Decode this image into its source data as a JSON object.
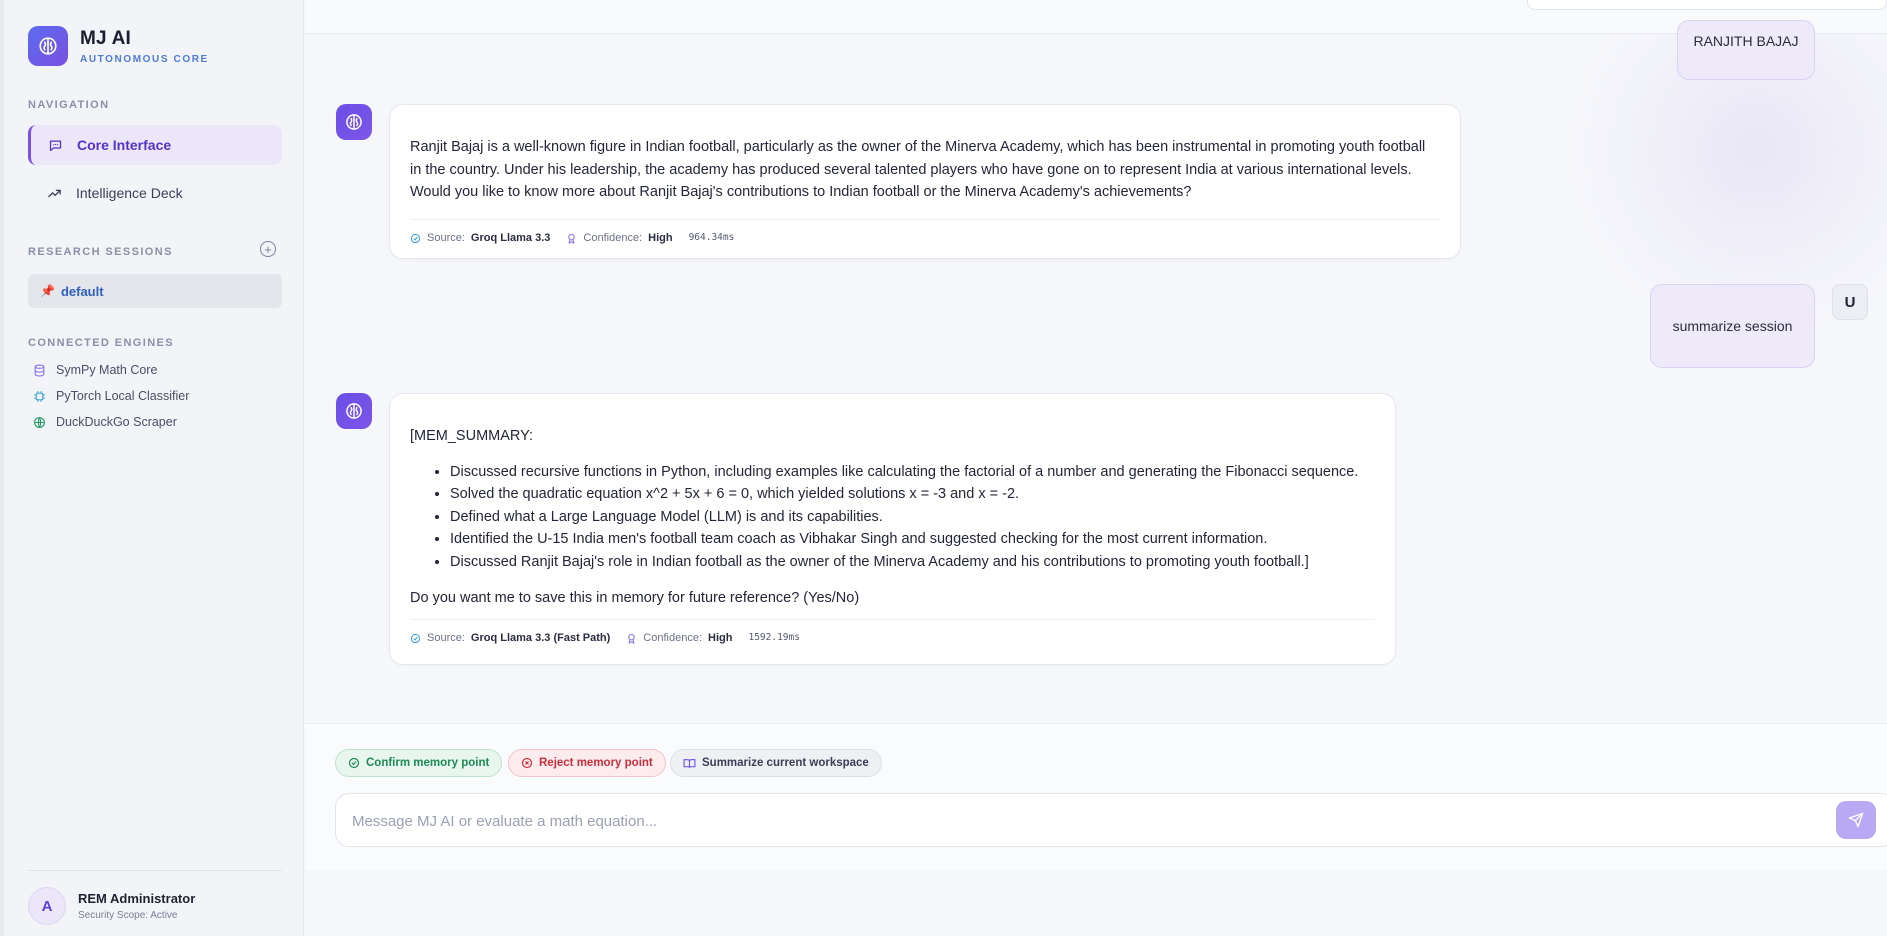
{
  "brand": {
    "title": "MJ AI",
    "subtitle": "AUTONOMOUS CORE"
  },
  "sidebar": {
    "navigation_label": "NAVIGATION",
    "nav_items": [
      {
        "label": "Core Interface",
        "icon": "chat-icon",
        "active": true
      },
      {
        "label": "Intelligence Deck",
        "icon": "trend-icon",
        "active": false
      }
    ],
    "sessions_label": "RESEARCH SESSIONS",
    "sessions": [
      {
        "label": "default",
        "icon": "pin-icon"
      }
    ],
    "engines_label": "CONNECTED ENGINES",
    "engines": [
      {
        "label": "SymPy Math Core",
        "icon": "database-icon",
        "color": "#8a6fe0"
      },
      {
        "label": "PyTorch Local Classifier",
        "icon": "cpu-icon",
        "color": "#3aa0d8"
      },
      {
        "label": "DuckDuckGo Scraper",
        "icon": "globe-icon",
        "color": "#1f9a63"
      }
    ],
    "user": {
      "initial": "A",
      "name": "REM Administrator",
      "scope": "Security Scope: Active"
    }
  },
  "chat": {
    "messages": [
      {
        "role": "user",
        "text": "RANJITH BAJAJ"
      },
      {
        "role": "ai",
        "text": "Ranjit Bajaj is a well-known figure in Indian football, particularly as the owner of the Minerva Academy, which has been instrumental in promoting youth football in the country. Under his leadership, the academy has produced several talented players who have gone on to represent India at various international levels. Would you like to know more about Ranjit Bajaj's contributions to Indian football or the Minerva Academy's achievements?",
        "source_label": "Source:",
        "source": "Groq Llama 3.3",
        "confidence_label": "Confidence:",
        "confidence": "High",
        "time": "964.34ms"
      },
      {
        "role": "user",
        "initial": "U",
        "text": "summarize session"
      },
      {
        "role": "ai",
        "heading": "[MEM_SUMMARY:",
        "bullets": [
          "Discussed recursive functions in Python, including examples like calculating the factorial of a number and generating the Fibonacci sequence.",
          "Solved the quadratic equation x^2 + 5x + 6 = 0, which yielded solutions x = -3 and x = -2.",
          "Defined what a Large Language Model (LLM) is and its capabilities.",
          "Identified the U-15 India men's football team coach as Vibhakar Singh and suggested checking for the most current information.",
          "Discussed Ranjit Bajaj's role in Indian football as the owner of the Minerva Academy and his contributions to promoting youth football.]"
        ],
        "footer": "Do you want me to save this in memory for future reference? (Yes/No)",
        "source_label": "Source:",
        "source": "Groq Llama 3.3 (Fast Path)",
        "confidence_label": "Confidence:",
        "confidence": "High",
        "time": "1592.19ms"
      }
    ]
  },
  "actions": {
    "confirm": "Confirm memory point",
    "reject": "Reject memory point",
    "summarize": "Summarize current workspace"
  },
  "composer": {
    "placeholder": "Message MJ AI or evaluate a math equation...",
    "value": ""
  },
  "colors": {
    "accent": "#6a4fe6",
    "confirm": "#1f8a55",
    "reject": "#c9303d"
  }
}
